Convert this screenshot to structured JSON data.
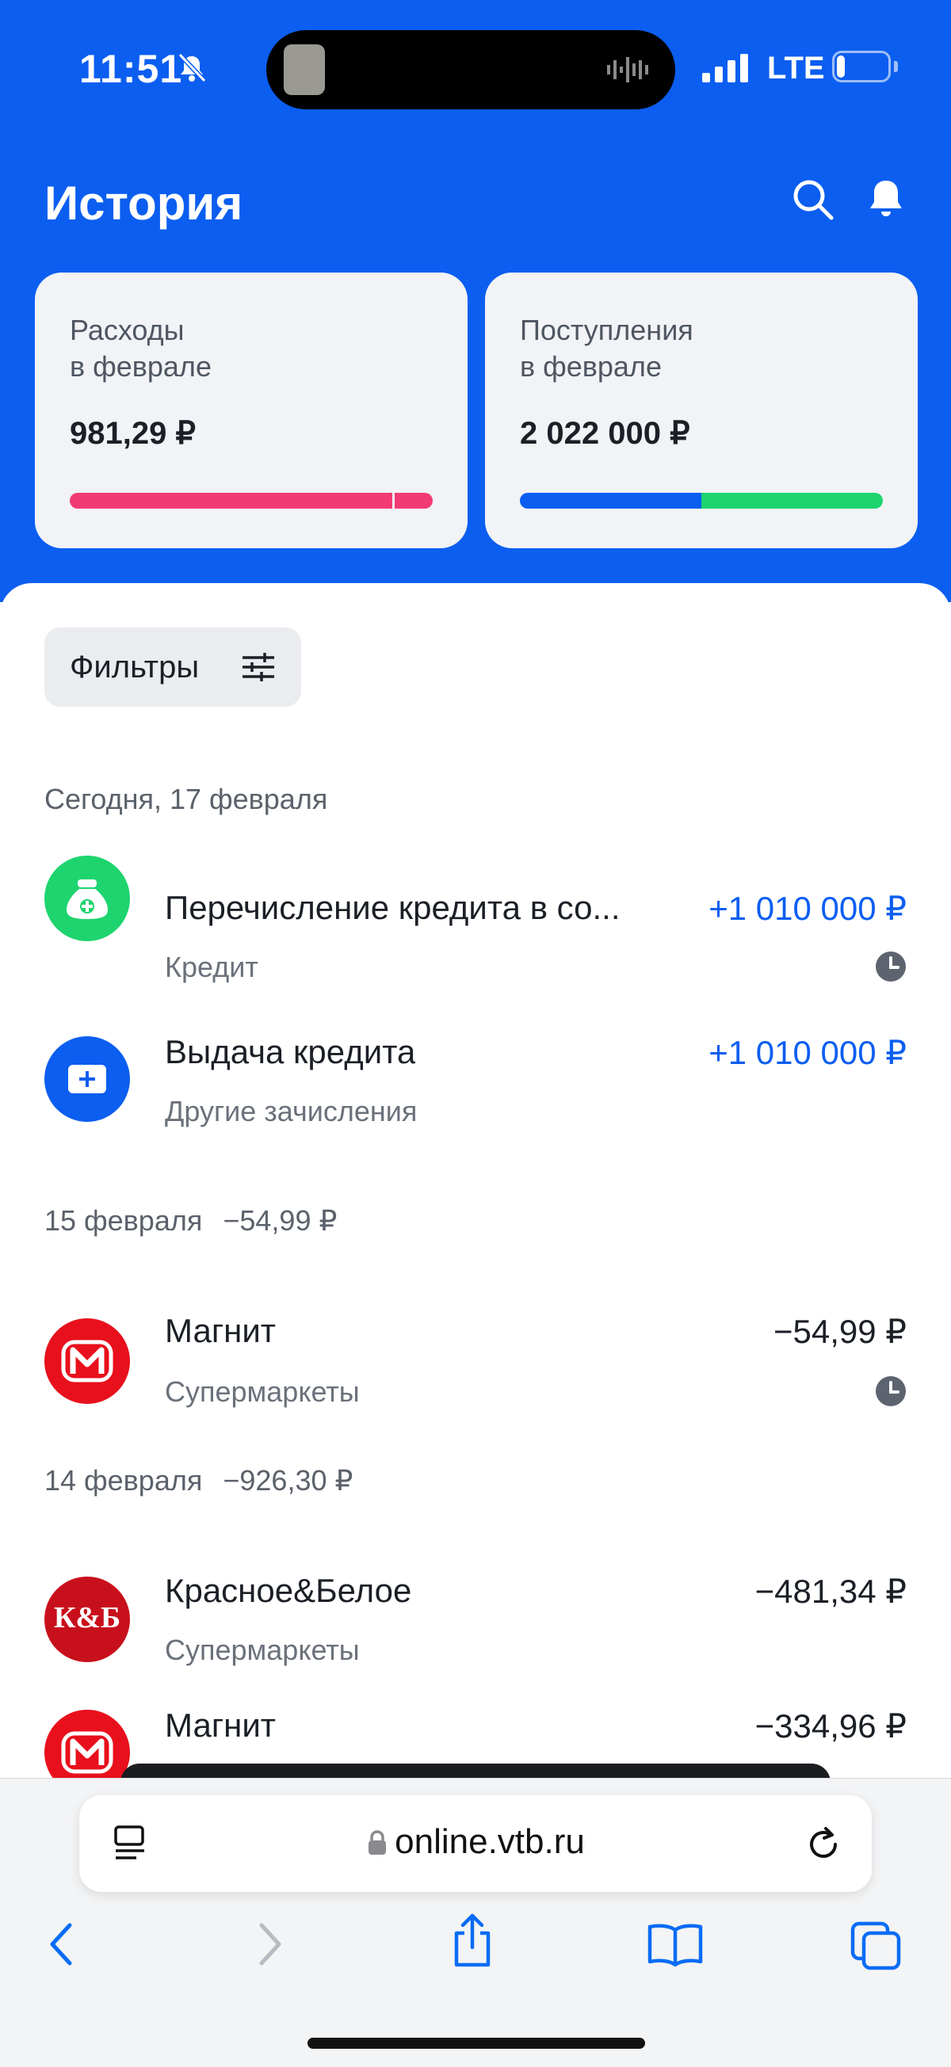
{
  "status_bar": {
    "time": "11:51",
    "network": "LTE",
    "battery": "23",
    "battery_level": 0.23
  },
  "header": {
    "title": "История"
  },
  "summary": {
    "expenses": {
      "label": "Расходы\nв феврале",
      "amount": "981,29 ₽",
      "bar_colors": [
        "#f23a74",
        "#f23a74"
      ],
      "bar_split": [
        0.888,
        0.112
      ]
    },
    "income": {
      "label": "Поступления\nв феврале",
      "amount": "2 022 000 ₽",
      "bar_colors": [
        "#0b5ef0",
        "#1ed46e"
      ],
      "bar_split": [
        0.5,
        0.5
      ]
    }
  },
  "filters": {
    "label": "Фильтры"
  },
  "groups": [
    {
      "date": "Сегодня, 17 февраля",
      "sum": ""
    },
    {
      "date": "15 февраля",
      "sum": "−54,99 ₽"
    },
    {
      "date": "14 февраля",
      "sum": "−926,30 ₽"
    }
  ],
  "transactions": [
    {
      "title": "Перечисление кредита в со...",
      "category": "Кредит",
      "amount": "+1 010 000 ₽",
      "icon": "money-bag-icon",
      "icon_bg": "#1ed46e",
      "pending": true
    },
    {
      "title": "Выдача кредита",
      "category": "Другие зачисления",
      "amount": "+1 010 000 ₽",
      "icon": "wallet-plus-icon",
      "icon_bg": "#0b5ef0",
      "pending": false
    },
    {
      "title": "Магнит",
      "category": "Супермаркеты",
      "amount": "−54,99 ₽",
      "icon": "magnit-logo-icon",
      "icon_bg": "#e8101c",
      "pending": true
    },
    {
      "title": "Красное&Белое",
      "category": "Супермаркеты",
      "amount": "−481,34 ₽",
      "icon": "krasnoe-beloe-logo-icon",
      "icon_bg": "#c8101c",
      "icon_text": "К&Б",
      "pending": false
    },
    {
      "title": "Магнит",
      "category": "",
      "amount": "−334,96 ₽",
      "icon": "magnit-logo-icon",
      "icon_bg": "#e8101c",
      "pending": false
    }
  ],
  "browser": {
    "url": "online.vtb.ru"
  },
  "colors": {
    "brand_blue": "#0b5ef0",
    "income_green": "#1ed46e",
    "expense_pink": "#f23a74"
  }
}
